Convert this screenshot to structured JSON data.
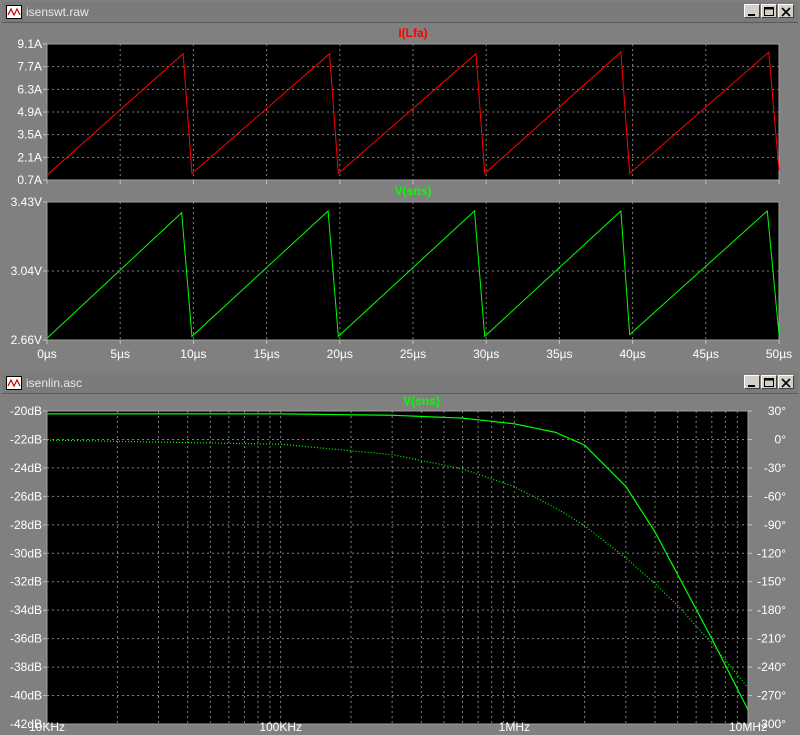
{
  "window1": {
    "title": "isenswt.raw",
    "pane1": {
      "trace_label": "I(Lfa)",
      "trace_color": "#ff0000",
      "y_ticks": [
        "9.1A",
        "7.7A",
        "6.3A",
        "4.9A",
        "3.5A",
        "2.1A",
        "0.7A"
      ]
    },
    "pane2": {
      "trace_label": "V(sns)",
      "trace_color": "#00ff00",
      "y_ticks": [
        "3.43V",
        "3.04V",
        "2.66V"
      ]
    },
    "x_ticks": [
      "0µs",
      "5µs",
      "10µs",
      "15µs",
      "20µs",
      "25µs",
      "30µs",
      "35µs",
      "40µs",
      "45µs",
      "50µs"
    ]
  },
  "window2": {
    "title": "isenlin.asc",
    "trace_label": "V(sns)",
    "trace_color": "#00ff00",
    "y_left_ticks": [
      "-20dB",
      "-22dB",
      "-24dB",
      "-26dB",
      "-28dB",
      "-30dB",
      "-32dB",
      "-34dB",
      "-36dB",
      "-38dB",
      "-40dB",
      "-42dB"
    ],
    "y_right_ticks": [
      "30°",
      "0°",
      "-30°",
      "-60°",
      "-90°",
      "-120°",
      "-150°",
      "-180°",
      "-210°",
      "-240°",
      "-270°",
      "-300°"
    ],
    "x_ticks": [
      "10KHz",
      "100KHz",
      "1MHz",
      "10MHz"
    ]
  },
  "chart_data": [
    {
      "type": "line",
      "title": "I(Lfa)",
      "x_unit": "µs",
      "xlim": [
        0,
        50
      ],
      "ylim": [
        0.7,
        9.1
      ],
      "series": [
        {
          "name": "I(Lfa)",
          "x": [
            0,
            9.3,
            9.9,
            19.3,
            19.9,
            29.3,
            29.9,
            39.2,
            39.8,
            49.3,
            50
          ],
          "y": [
            1.0,
            8.5,
            1.1,
            8.5,
            1.1,
            8.5,
            1.1,
            8.6,
            1.1,
            8.6,
            1.3
          ]
        }
      ]
    },
    {
      "type": "line",
      "title": "V(sns)",
      "x_unit": "µs",
      "xlim": [
        0,
        50
      ],
      "ylim": [
        2.66,
        3.43
      ],
      "series": [
        {
          "name": "V(sns)",
          "x": [
            0,
            9.2,
            9.9,
            19.2,
            19.9,
            29.2,
            29.9,
            39.2,
            39.8,
            49.2,
            50
          ],
          "y": [
            2.67,
            3.37,
            2.68,
            3.38,
            2.68,
            3.38,
            2.68,
            3.38,
            2.69,
            3.38,
            2.69
          ]
        }
      ]
    },
    {
      "type": "line",
      "title": "V(sns)",
      "x_scale": "log",
      "x_unit": "Hz",
      "xlim": [
        10000,
        10000000
      ],
      "ylim": [
        -42,
        -20
      ],
      "y2lim": [
        -300,
        30
      ],
      "series": [
        {
          "name": "V(sns)",
          "x": [
            10000,
            100000,
            300000,
            600000,
            1000000,
            1500000,
            2000000,
            3000000,
            4000000,
            5000000,
            7000000,
            10000000
          ],
          "y": [
            -20.2,
            -20.2,
            -20.3,
            -20.5,
            -20.9,
            -21.5,
            -22.4,
            -25.3,
            -28.5,
            -31.5,
            -36.0,
            -41.0
          ]
        },
        {
          "x": [
            10000,
            100000,
            300000,
            600000,
            1000000,
            1500000,
            2000000,
            3000000,
            4000000,
            5000000,
            7000000,
            10000000
          ],
          "y": [
            -0.7,
            -5,
            -16,
            -31,
            -50,
            -72,
            -91,
            -125,
            -152,
            -175,
            -215,
            -262
          ]
        }
      ]
    }
  ]
}
